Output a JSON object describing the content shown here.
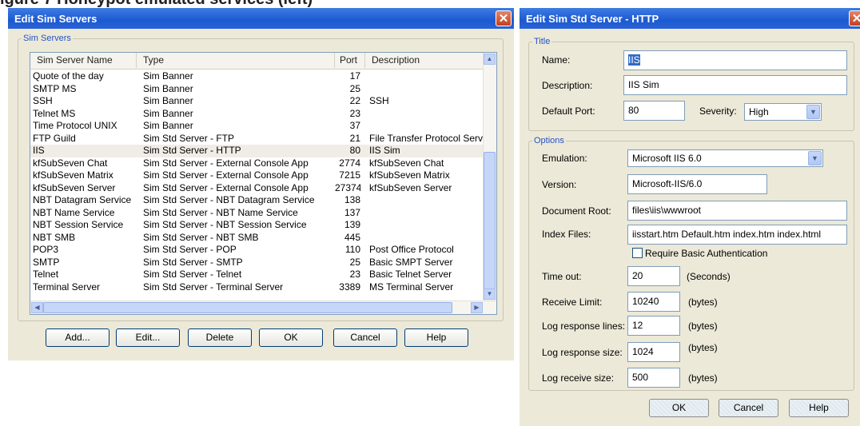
{
  "figure_title": "igure 7 Honeypot emulated services (left)",
  "left_dialog": {
    "title": "Edit Sim Servers",
    "group_label": "Sim Servers",
    "columns": [
      "Sim Server Name",
      "Type",
      "Port",
      "Description"
    ],
    "rows": [
      {
        "name": "Quote of the day",
        "type": "Sim Banner",
        "port": "17",
        "desc": ""
      },
      {
        "name": "SMTP MS",
        "type": "Sim Banner",
        "port": "25",
        "desc": ""
      },
      {
        "name": "SSH",
        "type": "Sim Banner",
        "port": "22",
        "desc": "SSH"
      },
      {
        "name": "Telnet MS",
        "type": "Sim Banner",
        "port": "23",
        "desc": ""
      },
      {
        "name": "Time Protocol UNIX",
        "type": "Sim Banner",
        "port": "37",
        "desc": ""
      },
      {
        "name": "FTP Guild",
        "type": "Sim Std Server - FTP",
        "port": "21",
        "desc": "File Transfer Protocol Serv"
      },
      {
        "name": "IIS",
        "type": "Sim Std Server - HTTP",
        "port": "80",
        "desc": "IIS Sim"
      },
      {
        "name": "kfSubSeven Chat",
        "type": "Sim Std Server - External Console App",
        "port": "2774",
        "desc": "kfSubSeven Chat"
      },
      {
        "name": "kfSubSeven Matrix",
        "type": "Sim Std Server - External Console App",
        "port": "7215",
        "desc": "kfSubSeven Matrix"
      },
      {
        "name": "kfSubSeven Server",
        "type": "Sim Std Server - External Console App",
        "port": "27374",
        "desc": "kfSubSeven Server"
      },
      {
        "name": "NBT Datagram Service",
        "type": "Sim Std Server - NBT Datagram Service",
        "port": "138",
        "desc": ""
      },
      {
        "name": "NBT Name Service",
        "type": "Sim Std Server - NBT Name Service",
        "port": "137",
        "desc": ""
      },
      {
        "name": "NBT Session Service",
        "type": "Sim Std Server - NBT Session Service",
        "port": "139",
        "desc": ""
      },
      {
        "name": "NBT SMB",
        "type": "Sim Std Server - NBT SMB",
        "port": "445",
        "desc": ""
      },
      {
        "name": "POP3",
        "type": "Sim Std Server - POP",
        "port": "110",
        "desc": "Post Office Protocol"
      },
      {
        "name": "SMTP",
        "type": "Sim Std Server - SMTP",
        "port": "25",
        "desc": "Basic SMPT Server"
      },
      {
        "name": "Telnet",
        "type": "Sim Std Server - Telnet",
        "port": "23",
        "desc": "Basic Telnet Server"
      },
      {
        "name": "Terminal Server",
        "type": "Sim Std Server - Terminal Server",
        "port": "3389",
        "desc": "MS Terminal Server"
      }
    ],
    "selected_row": 6,
    "buttons": {
      "add": "Add...",
      "edit": "Edit...",
      "delete": "Delete",
      "ok": "OK",
      "cancel": "Cancel",
      "help": "Help"
    }
  },
  "right_dialog": {
    "title": "Edit Sim Std Server - HTTP",
    "title_group": "Title",
    "name_label": "Name:",
    "name_value": "IIS",
    "description_label": "Description:",
    "description_value": "IIS Sim",
    "port_label": "Default Port:",
    "port_value": "80",
    "severity_label": "Severity:",
    "severity_value": "High",
    "options_group": "Options",
    "emulation_label": "Emulation:",
    "emulation_value": "Microsoft IIS 6.0",
    "version_label": "Version:",
    "version_value": "Microsoft-IIS/6.0",
    "docroot_label": "Document Root:",
    "docroot_value": "files\\iis\\wwwroot",
    "index_label": "Index Files:",
    "index_value": "iisstart.htm Default.htm index.htm index.html",
    "auth_label": "Require Basic Authentication",
    "timeout_label": "Time out:",
    "timeout_value": "20",
    "timeout_unit": "(Seconds)",
    "recv_limit_label": "Receive Limit:",
    "recv_limit_value": "10240",
    "recv_limit_unit": "(bytes)",
    "log_lines_label": "Log response lines:",
    "log_lines_value": "12",
    "log_lines_unit": "(bytes)",
    "log_size_label": "Log response size:",
    "log_size_value": "1024",
    "log_size_unit": "(bytes)",
    "log_recv_label": "Log receive size:",
    "log_recv_value": "500",
    "log_recv_unit": "(bytes)",
    "buttons": {
      "ok": "OK",
      "cancel": "Cancel",
      "help": "Help"
    }
  },
  "close_glyph": "✕"
}
